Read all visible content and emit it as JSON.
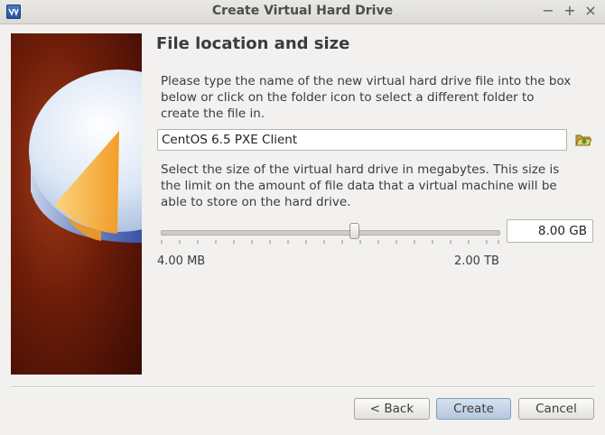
{
  "window": {
    "title": "Create Virtual Hard Drive",
    "minimize_glyph": "−",
    "maximize_glyph": "+",
    "close_glyph": "×"
  },
  "page": {
    "heading": "File location and size",
    "location_instructions": "Please type the name of the new virtual hard drive file into the box below or click on the folder icon to select a different folder to create the file in.",
    "file_name_value": "CentOS 6.5 PXE Client",
    "size_instructions": "Select the size of the virtual hard drive in megabytes. This size is the limit on the amount of file data that a virtual machine will be able to store on the hard drive.",
    "size_slider": {
      "min_label": "4.00 MB",
      "max_label": "2.00 TB",
      "position_fraction": 0.56
    },
    "size_value": "8.00 GB"
  },
  "buttons": {
    "back_label": "< Back",
    "create_label": "Create",
    "cancel_label": "Cancel"
  },
  "icons": {
    "app": "virtualbox-icon",
    "folder": "folder-icon",
    "banner": "hard-drive-illustration"
  },
  "colors": {
    "accent": "#f29a1d",
    "banner_bg": "#6e1d09",
    "default_button": "#b5c8de"
  }
}
